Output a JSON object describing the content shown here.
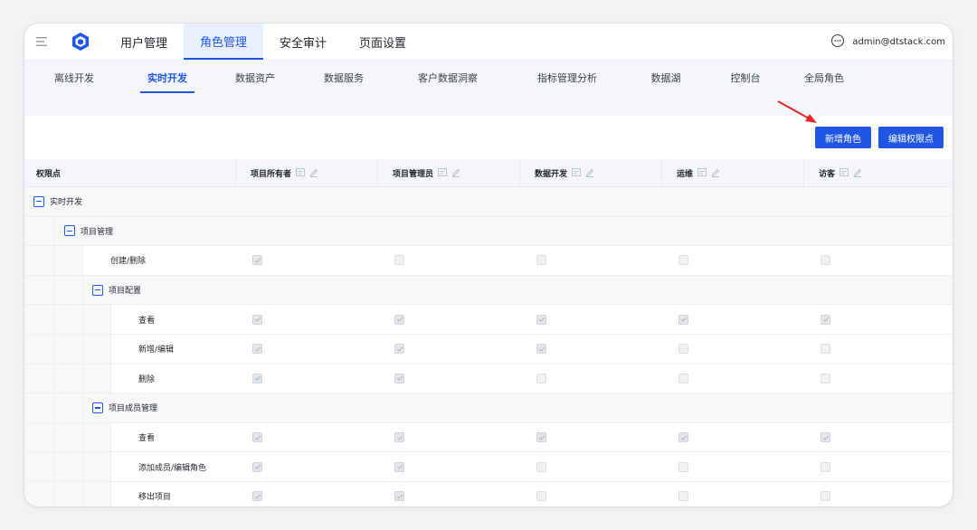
{
  "topnav": {
    "items": [
      {
        "label": "用户管理",
        "active": false
      },
      {
        "label": "角色管理",
        "active": true
      },
      {
        "label": "安全审计",
        "active": false
      },
      {
        "label": "页面设置",
        "active": false
      }
    ],
    "user": "admin@dtstack.com",
    "icons": [
      "menu-icon",
      "logo-icon",
      "chat-icon"
    ]
  },
  "subtabs": [
    {
      "label": "离线开发",
      "active": false
    },
    {
      "label": "实时开发",
      "active": true
    },
    {
      "label": "数据资产",
      "active": false
    },
    {
      "label": "数据服务",
      "active": false
    },
    {
      "label": "客户数据洞察",
      "active": false
    },
    {
      "label": "指标管理分析",
      "active": false
    },
    {
      "label": "数据湖",
      "active": false
    },
    {
      "label": "控制台",
      "active": false
    },
    {
      "label": "全局角色",
      "active": false
    }
  ],
  "toolbar": {
    "add_role_label": "新增角色",
    "edit_permission_label": "编辑权限点"
  },
  "colors": {
    "accent": "#1f56e6",
    "arrow": "#e8242a"
  },
  "table": {
    "header_first": "权限点",
    "roles": [
      "项目所有者",
      "项目管理员",
      "数据开发",
      "运维",
      "访客"
    ],
    "rows": [
      {
        "label": "实时开发",
        "type": "group",
        "level": 0,
        "checks": null
      },
      {
        "label": "项目管理",
        "type": "group",
        "level": 1,
        "checks": null
      },
      {
        "label": "创建/删除",
        "type": "item",
        "level": 2,
        "checks": [
          true,
          false,
          false,
          false,
          false
        ]
      },
      {
        "label": "项目配置",
        "type": "group",
        "level": 2,
        "checks": null
      },
      {
        "label": "查看",
        "type": "item",
        "level": 3,
        "checks": [
          true,
          true,
          true,
          true,
          true
        ]
      },
      {
        "label": "新增/编辑",
        "type": "item",
        "level": 3,
        "checks": [
          true,
          true,
          true,
          false,
          false
        ]
      },
      {
        "label": "删除",
        "type": "item",
        "level": 3,
        "checks": [
          true,
          true,
          false,
          false,
          false
        ]
      },
      {
        "label": "项目成员管理",
        "type": "group",
        "level": 2,
        "checks": null
      },
      {
        "label": "查看",
        "type": "item",
        "level": 3,
        "checks": [
          true,
          true,
          true,
          true,
          true
        ]
      },
      {
        "label": "添加成员/编辑角色",
        "type": "item",
        "level": 3,
        "checks": [
          true,
          true,
          false,
          false,
          false
        ]
      },
      {
        "label": "移出项目",
        "type": "item",
        "level": 3,
        "checks": [
          true,
          true,
          false,
          false,
          false
        ]
      }
    ]
  }
}
